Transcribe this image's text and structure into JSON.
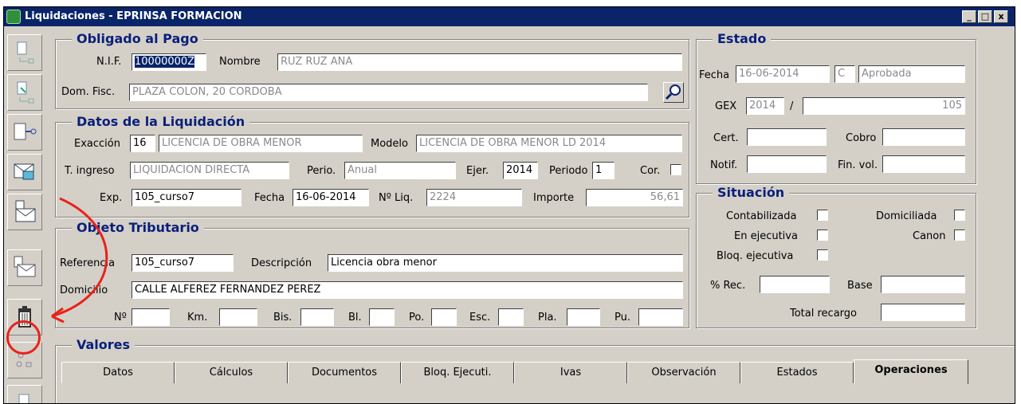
{
  "window": {
    "title": "Liquidaciones - EPRINSA FORMACION",
    "controls": [
      "_",
      "□",
      "x"
    ]
  },
  "toolbar": {
    "icons": [
      "document-link-icon",
      "document-edit-icon",
      "transfer-icon",
      "mail-out-icon",
      "mail-doc-icon",
      "mail-in-icon",
      "trash-icon",
      "settings-icon",
      "document-icon"
    ]
  },
  "obligado": {
    "legend": "Obligado al Pago",
    "nif_label": "N.I.F.",
    "nif_value": "10000000Z",
    "nombre_label": "Nombre",
    "nombre_value": "RUZ RUZ ANA",
    "dom_label": "Dom. Fisc.",
    "dom_value": "PLAZA COLON, 20 CORDOBA"
  },
  "datos": {
    "legend": "Datos de la Liquidación",
    "exaccion_label": "Exacción",
    "exaccion_code": "16",
    "exaccion_desc": "LICENCIA DE OBRA MENOR",
    "modelo_label": "Modelo",
    "modelo_value": "LICENCIA DE OBRA MENOR LD 2014",
    "tingreso_label": "T. ingreso",
    "tingreso_value": "LIQUIDACION DIRECTA",
    "perio_label": "Perio.",
    "perio_value": "Anual",
    "ejer_label": "Ejer.",
    "ejer_value": "2014",
    "periodo_label": "Periodo",
    "periodo_value": "1",
    "cor_label": "Cor.",
    "exp_label": "Exp.",
    "exp_value": "105_curso7",
    "fecha_label": "Fecha",
    "fecha_value": "16-06-2014",
    "nliq_label": "Nº Liq.",
    "nliq_value": "2224",
    "importe_label": "Importe",
    "importe_value": "56,61"
  },
  "objeto": {
    "legend": "Objeto Tributario",
    "ref_label": "Referencia",
    "ref_value": "105_curso7",
    "desc_label": "Descripción",
    "desc_value": "Licencia obra menor",
    "domicilio_label": "Domicilio",
    "domicilio_value": "CALLE ALFEREZ FERNANDEZ PEREZ",
    "no_label": "Nº",
    "km_label": "Km.",
    "bis_label": "Bis.",
    "bl_label": "Bl.",
    "po_label": "Po.",
    "esc_label": "Esc.",
    "pla_label": "Pla.",
    "pu_label": "Pu."
  },
  "estado": {
    "legend": "Estado",
    "fecha_label": "Fecha",
    "fecha_value": "16-06-2014",
    "code_value": "C",
    "status_value": "Aprobada",
    "gex_label": "GEX",
    "gex_year": "2014",
    "gex_sep": "/",
    "gex_number": "105",
    "cert_label": "Cert.",
    "cobro_label": "Cobro",
    "notif_label": "Notif.",
    "finvol_label": "Fin. vol."
  },
  "situacion": {
    "legend": "Situación",
    "contabilizada": "Contabilizada",
    "domiciliada": "Domiciliada",
    "ejecutiva": "En ejecutiva",
    "canon": "Canon",
    "bloq": "Bloq. ejecutiva",
    "rec_label": "% Rec.",
    "base_label": "Base",
    "total_label": "Total recargo"
  },
  "valores": {
    "legend": "Valores",
    "tabs": [
      "Datos",
      "Cálculos",
      "Documentos",
      "Bloq. Ejecuti.",
      "Ivas",
      "Observación",
      "Estados",
      "Operaciones"
    ],
    "active_tab": "Operaciones"
  },
  "colors": {
    "title_bar": "#0a246a",
    "legend_text": "#0a1f7a",
    "annotation": "#e8231b",
    "face": "#d4d0c8"
  }
}
